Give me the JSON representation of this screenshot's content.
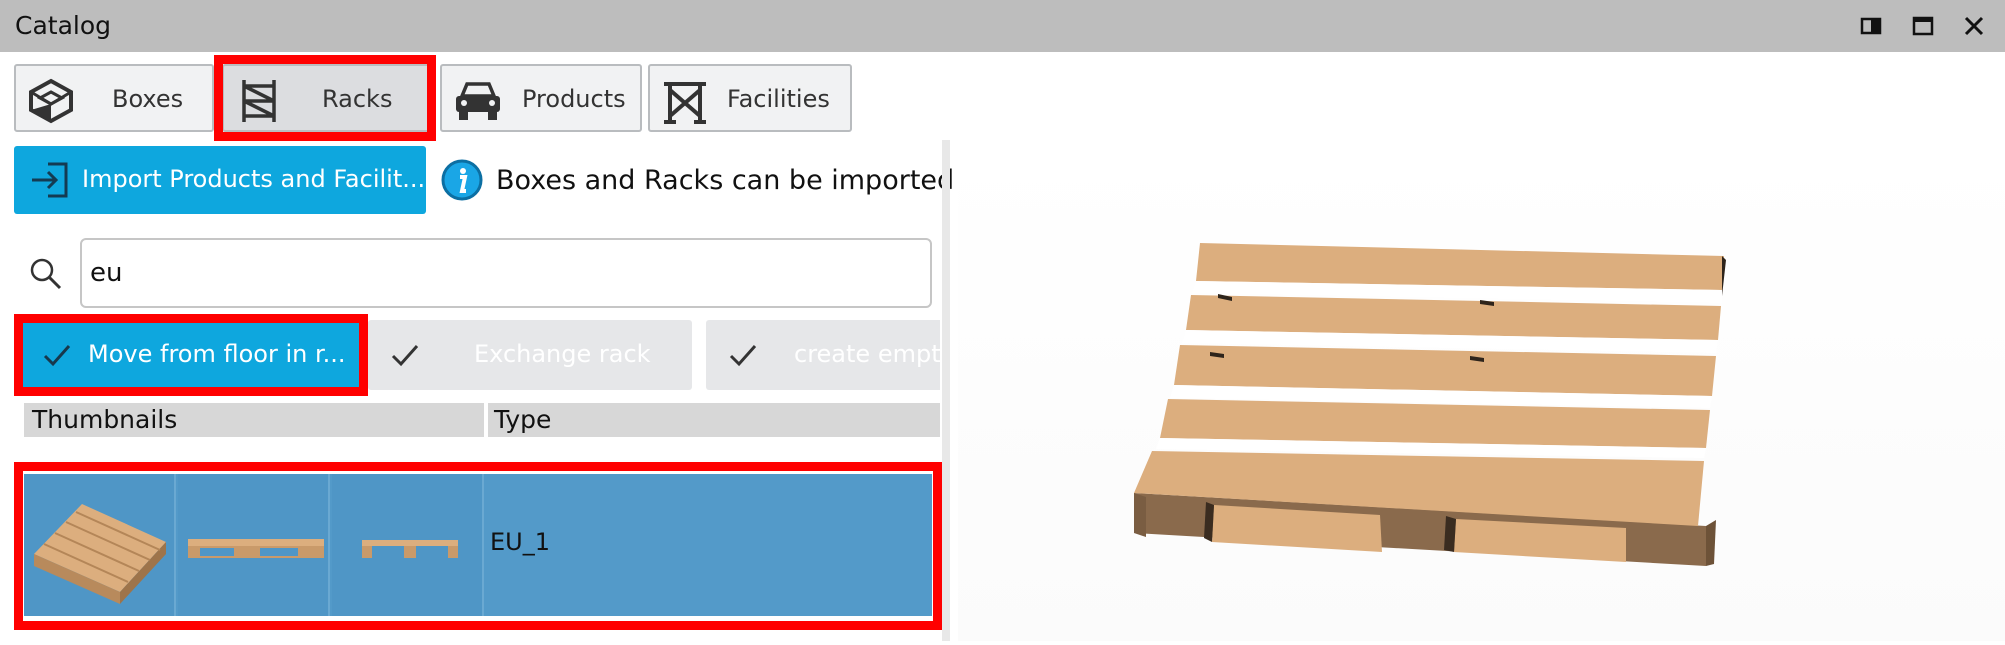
{
  "window": {
    "title": "Catalog"
  },
  "window_controls": {
    "dock_icon": "dock-icon",
    "maximize_icon": "maximize-icon",
    "close_icon": "close-icon"
  },
  "tabs": [
    {
      "label": "Boxes",
      "icon": "box-icon"
    },
    {
      "label": "Racks",
      "icon": "rack-icon"
    },
    {
      "label": "Products",
      "icon": "car-icon"
    },
    {
      "label": "Facilities",
      "icon": "facility-icon"
    }
  ],
  "import_button": {
    "label": "Import Products and Facilit..."
  },
  "info": {
    "text": "Boxes and Racks can be imported via"
  },
  "search": {
    "value": "eu",
    "icon": "search-icon"
  },
  "filters": [
    {
      "label": "Move from floor in r...",
      "active": true
    },
    {
      "label": "Exchange rack",
      "active": false
    },
    {
      "label": "create empty",
      "active": false
    }
  ],
  "table": {
    "headers": [
      "Thumbnails",
      "Type"
    ],
    "rows": [
      {
        "type": "EU_1"
      }
    ]
  },
  "colors": {
    "accent": "#0ea7de",
    "highlight": "#ff0000",
    "selection": "#539ac9",
    "pallet": "#dcae7e"
  }
}
